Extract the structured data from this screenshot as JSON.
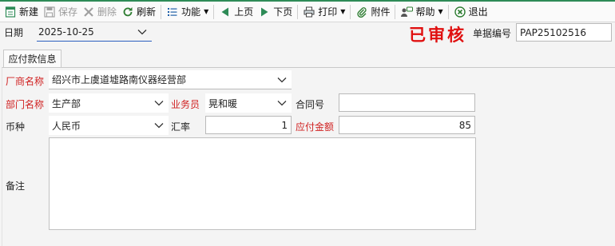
{
  "toolbar": {
    "new": "新建",
    "save": "保存",
    "delete": "删除",
    "refresh": "刷新",
    "functions": "功能",
    "prev_page": "上页",
    "next_page": "下页",
    "print": "打印",
    "attachment": "附件",
    "help": "帮助",
    "exit": "退出"
  },
  "header": {
    "date_label": "日期",
    "date_value": "2025-10-25",
    "status_stamp": "已审核",
    "doc_no_label": "单据编号",
    "doc_no_value": "PAP25102516"
  },
  "tab": {
    "label": "应付款信息"
  },
  "form": {
    "vendor_label": "厂商名称",
    "vendor_value": "绍兴市上虞道墟路南仪器经营部",
    "dept_label": "部门名称",
    "dept_value": "生产部",
    "salesman_label": "业务员",
    "salesman_value": "晃和暖",
    "contract_label": "合同号",
    "contract_value": "",
    "currency_label": "币种",
    "currency_value": "人民币",
    "rate_label": "汇率",
    "rate_value": "1",
    "amount_label": "应付金额",
    "amount_value": "85",
    "remark_label": "备注",
    "remark_value": ""
  },
  "colors": {
    "required_label": "#d02020",
    "stamp": "#e01010",
    "toolbar_accent": "#2e8b57"
  }
}
